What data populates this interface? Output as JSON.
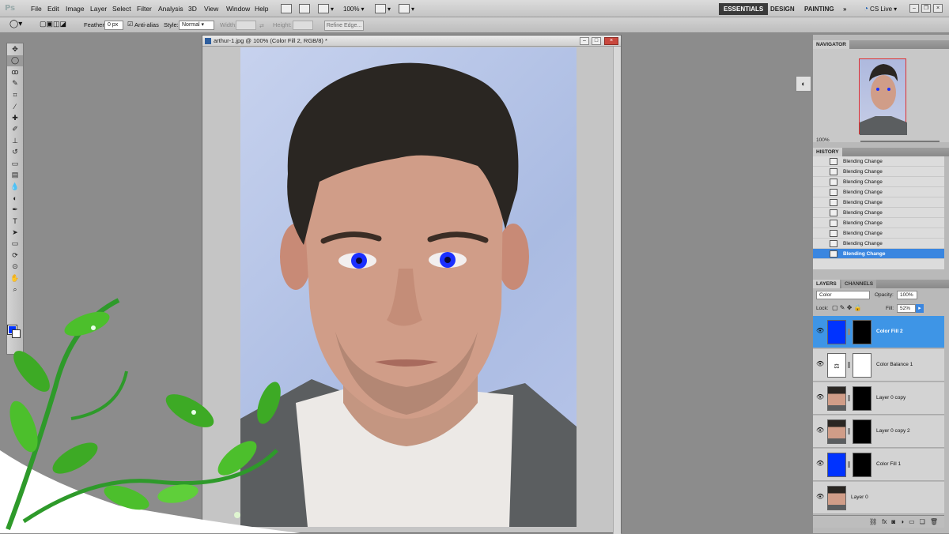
{
  "menubar": {
    "logo": "Ps",
    "items": [
      "File",
      "Edit",
      "Image",
      "Layer",
      "Select",
      "Filter",
      "Analysis",
      "3D",
      "View",
      "Window",
      "Help"
    ],
    "zoom": "100%",
    "workspaces": [
      "ESSENTIALS",
      "DESIGN",
      "PAINTING"
    ],
    "more": "»",
    "cslive": "CS Live"
  },
  "options": {
    "feather_label": "Feather:",
    "feather_value": "0 px",
    "antialias_label": "Anti-alias",
    "style_label": "Style:",
    "style_value": "Normal",
    "width_label": "Width:",
    "height_label": "Height:",
    "refine_edge": "Refine Edge..."
  },
  "document": {
    "title": "arthur-1.jpg @ 100% (Color Fill 2, RGB/8) *"
  },
  "navigator": {
    "tab": "NAVIGATOR",
    "zoom": "100%"
  },
  "history": {
    "tab": "HISTORY",
    "items": [
      "Blending Change",
      "Blending Change",
      "Blending Change",
      "Blending Change",
      "Blending Change",
      "Blending Change",
      "Blending Change",
      "Blending Change",
      "Blending Change",
      "Blending Change"
    ],
    "selected_index": 9
  },
  "layers_panel": {
    "tabs": [
      "LAYERS",
      "CHANNELS"
    ],
    "blend_mode": "Color",
    "opacity_label": "Opacity:",
    "opacity_value": "100%",
    "lock_label": "Lock:",
    "fill_label": "Fill:",
    "fill_value": "52%",
    "layers": [
      {
        "name": "Color Fill 2",
        "selected": true,
        "thumb": "blue-fill"
      },
      {
        "name": "Color Balance 1",
        "selected": false,
        "thumb": "adjustment"
      },
      {
        "name": "Layer 0 copy",
        "selected": false,
        "thumb": "photo"
      },
      {
        "name": "Layer 0 copy 2",
        "selected": false,
        "thumb": "photo"
      },
      {
        "name": "Color Fill 1",
        "selected": false,
        "thumb": "blue-fill"
      },
      {
        "name": "Layer 0",
        "selected": false,
        "thumb": "photo"
      }
    ],
    "footer_icons": [
      "link-icon",
      "fx-icon",
      "mask-icon",
      "adjustment-icon",
      "group-icon",
      "new-layer-icon",
      "trash-icon"
    ]
  },
  "colors": {
    "foreground": "#0033ff",
    "background": "#ffffff",
    "selection": "#3e95e6",
    "eye_tint": "#1a2fff"
  }
}
